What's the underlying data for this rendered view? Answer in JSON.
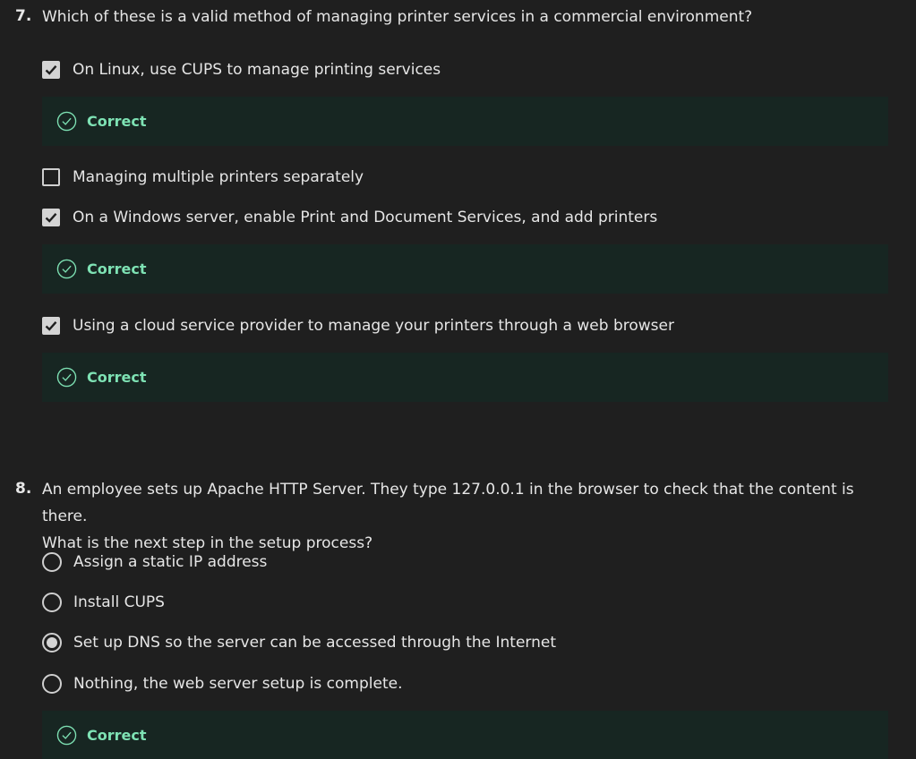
{
  "questions": [
    {
      "number": "7.",
      "text": "Which of these is a valid method of managing printer services in a commercial environment?",
      "options": [
        {
          "label": "On Linux, use CUPS to manage printing services",
          "checked": true
        },
        {
          "label": "Managing multiple printers separately",
          "checked": false
        },
        {
          "label": "On a Windows server, enable Print and Document Services, and add printers",
          "checked": true
        },
        {
          "label": "Using a cloud service provider to manage your printers through a web browser",
          "checked": true
        }
      ],
      "feedback": [
        "Correct",
        "Correct",
        "Correct"
      ]
    },
    {
      "number": "8.",
      "text_line1": "An employee sets up Apache HTTP Server. They type 127.0.0.1 in the browser to check that the content is there.",
      "text_line2": "What is the next step in the setup process?",
      "options": [
        {
          "label": "Assign a static IP address",
          "selected": false
        },
        {
          "label": "Install CUPS",
          "selected": false
        },
        {
          "label": "Set up DNS so the server can be accessed through the Internet",
          "selected": true
        },
        {
          "label": "Nothing, the web server setup is complete.",
          "selected": false
        }
      ],
      "feedback": [
        "Correct"
      ]
    }
  ],
  "colors": {
    "background": "#1f1f1f",
    "feedback_background": "#172622",
    "correct_text": "#7ee2b4"
  },
  "icons": {
    "checkbox_checked": "checkmark-icon",
    "feedback": "check-circle-icon"
  }
}
